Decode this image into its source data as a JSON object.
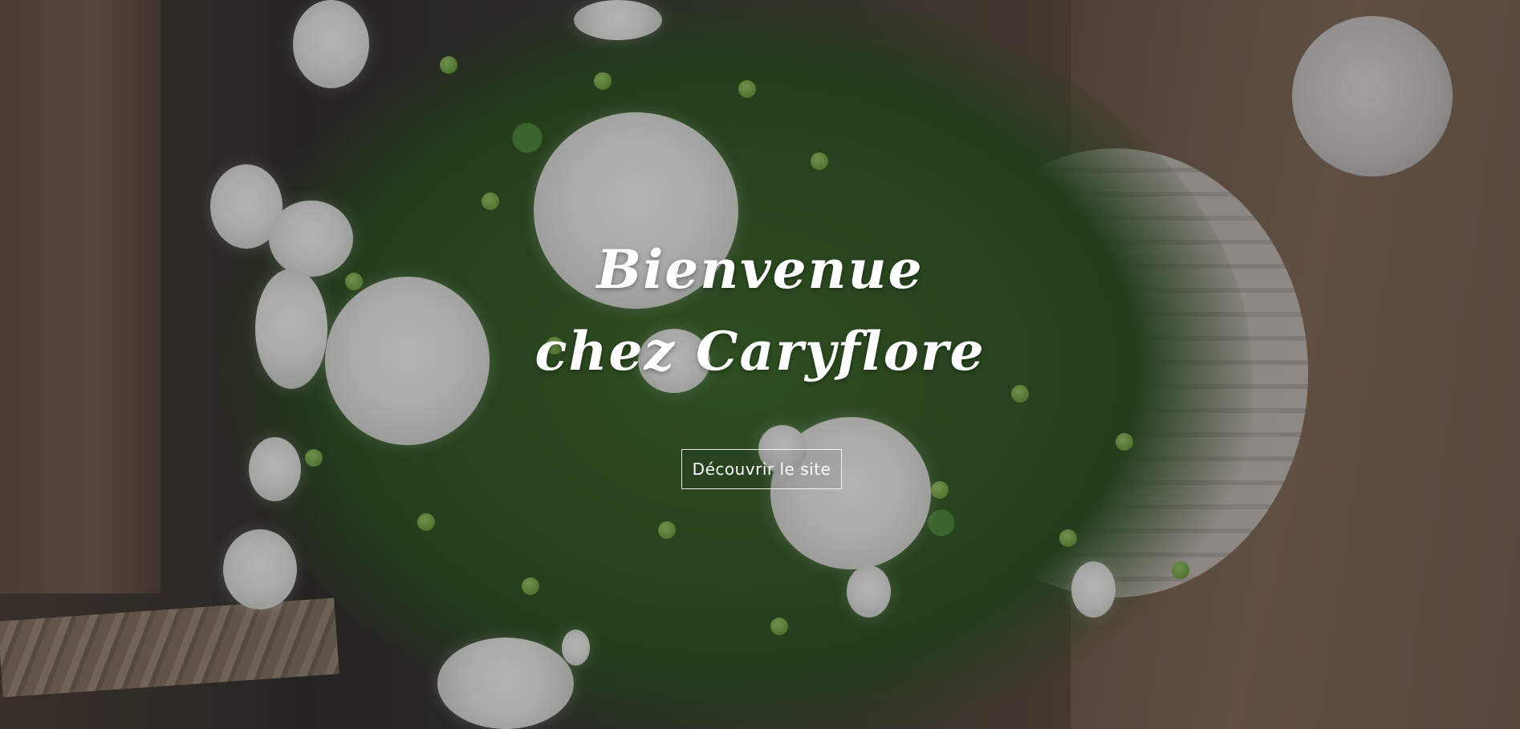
{
  "hero": {
    "title_line1": "Bienvenue",
    "title_line2": "chez Caryflore",
    "cta_label": "Découvrir le site"
  },
  "colors": {
    "text": "#ffffff",
    "overlay": "rgba(20,20,20,0.32)",
    "foliage": "#3b6a2a"
  }
}
